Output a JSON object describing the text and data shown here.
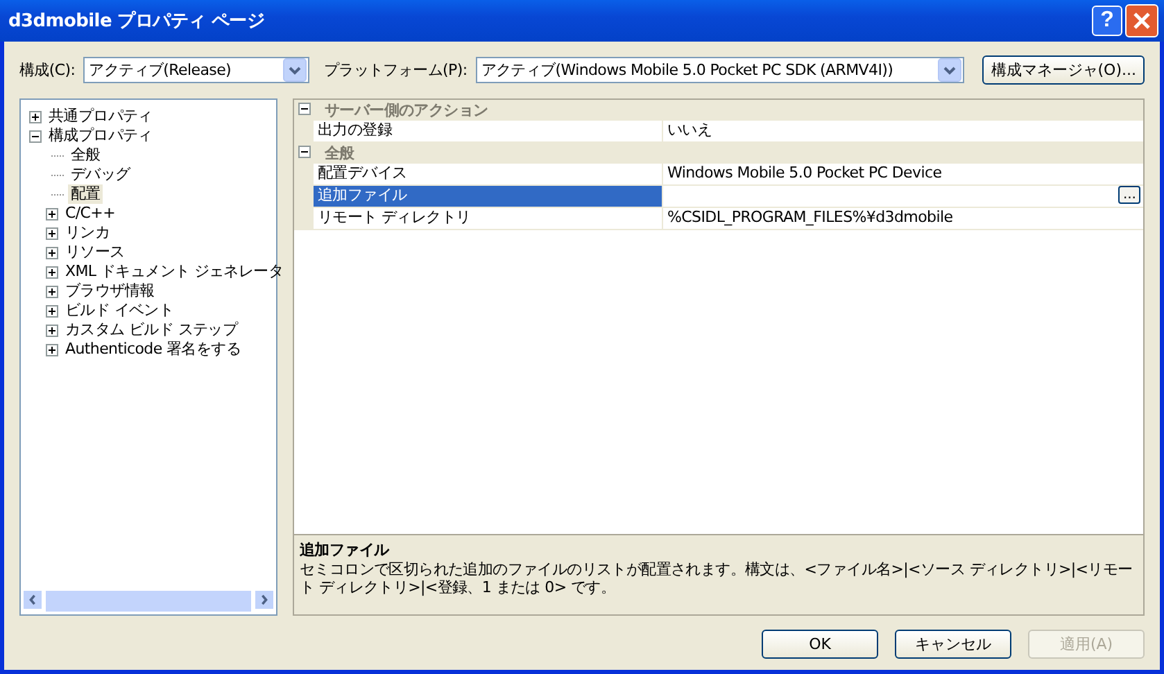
{
  "window": {
    "title": "d3dmobile プロパティ ページ",
    "help_button": "?"
  },
  "toolbar": {
    "config_label": "構成(C):",
    "config_value": "アクティブ(Release)",
    "platform_label": "プラットフォーム(P):",
    "platform_value": "アクティブ(Windows Mobile 5.0 Pocket PC SDK (ARMV4I))",
    "manager_button": "構成マネージャ(O)..."
  },
  "tree": [
    {
      "label": "共通プロパティ",
      "expanded": false,
      "selected": false
    },
    {
      "label": "構成プロパティ",
      "expanded": true,
      "selected": false,
      "children": [
        {
          "label": "全般",
          "selected": false
        },
        {
          "label": "デバッグ",
          "selected": false
        },
        {
          "label": "配置",
          "selected": true
        },
        {
          "label": "C/C++",
          "expanded": false,
          "selected": false
        },
        {
          "label": "リンカ",
          "expanded": false,
          "selected": false
        },
        {
          "label": "リソース",
          "expanded": false,
          "selected": false
        },
        {
          "label": "XML ドキュメント ジェネレータ",
          "expanded": false,
          "selected": false
        },
        {
          "label": "ブラウザ情報",
          "expanded": false,
          "selected": false
        },
        {
          "label": "ビルド イベント",
          "expanded": false,
          "selected": false
        },
        {
          "label": "カスタム ビルド ステップ",
          "expanded": false,
          "selected": false
        },
        {
          "label": "Authenticode 署名をする",
          "expanded": false,
          "selected": false
        }
      ]
    }
  ],
  "properties": [
    {
      "category": "サーバー側のアクション",
      "expanded": true,
      "rows": [
        {
          "name": "出力の登録",
          "value": "いいえ",
          "selected": false
        }
      ]
    },
    {
      "category": "全般",
      "expanded": true,
      "rows": [
        {
          "name": "配置デバイス",
          "value": "Windows Mobile 5.0 Pocket PC Device",
          "selected": false
        },
        {
          "name": "追加ファイル",
          "value": "",
          "selected": true,
          "browse_button": "..."
        },
        {
          "name": "リモート ディレクトリ",
          "value": "%CSIDL_PROGRAM_FILES%¥d3dmobile",
          "selected": false
        }
      ]
    }
  ],
  "description": {
    "title": "追加ファイル",
    "text": "セミコロンで区切られた追加のファイルのリストが配置されます。構文は、<ファイル名>|<ソース ディレクトリ>|<リモート ディレクトリ>|<登録、1 または 0> です。"
  },
  "buttons": [
    {
      "label": "OK",
      "disabled": false
    },
    {
      "label": "キャンセル",
      "disabled": false
    },
    {
      "label": "適用(A)",
      "disabled": true
    }
  ]
}
